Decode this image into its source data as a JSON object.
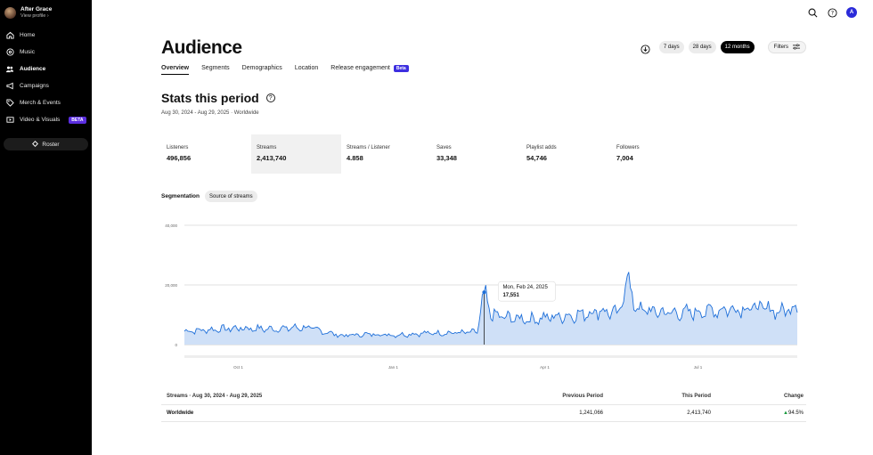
{
  "sidebar": {
    "profile": {
      "name": "After Grace",
      "sub": "View profile ›"
    },
    "items": [
      {
        "label": "Home",
        "icon": "home-icon"
      },
      {
        "label": "Music",
        "icon": "music-disc-icon"
      },
      {
        "label": "Audience",
        "icon": "audience-icon",
        "active": true
      },
      {
        "label": "Campaigns",
        "icon": "megaphone-icon"
      },
      {
        "label": "Merch & Events",
        "icon": "tag-icon"
      },
      {
        "label": "Video & Visuals",
        "icon": "video-icon",
        "badge": "BETA"
      }
    ],
    "roster": "Roster"
  },
  "header": {
    "avatar_letter": "A"
  },
  "page": {
    "title": "Audience",
    "periods": [
      "7 days",
      "28 days",
      "12 months"
    ],
    "selected_period": "12 months",
    "filters": "Filters",
    "tabs": [
      {
        "label": "Overview",
        "active": true
      },
      {
        "label": "Segments"
      },
      {
        "label": "Demographics"
      },
      {
        "label": "Location"
      },
      {
        "label": "Release engagement",
        "badge": "Beta"
      }
    ],
    "section_title": "Stats this period",
    "date_range": "Aug 30, 2024 - Aug 29, 2025 · Worldwide",
    "stats": [
      {
        "label": "Listeners",
        "value": "496,856"
      },
      {
        "label": "Streams",
        "value": "2,413,740",
        "active": true
      },
      {
        "label": "Streams / Listener",
        "value": "4.858"
      },
      {
        "label": "Saves",
        "value": "33,348"
      },
      {
        "label": "Playlist adds",
        "value": "54,746"
      },
      {
        "label": "Followers",
        "value": "7,004"
      }
    ],
    "segmentation_label": "Segmentation",
    "segmentation_value": "Source of streams"
  },
  "chart_data": {
    "type": "area",
    "ylim": [
      0,
      40000
    ],
    "y_ticks": [
      "0",
      "20,000",
      "40,000"
    ],
    "x_ticks": [
      "Oct 1",
      "Jan 1",
      "Apr 1",
      "Jul 1"
    ],
    "x": [
      "Aug 30, 2024",
      "Sep 15, 2024",
      "Oct 1, 2024",
      "Oct 20, 2024",
      "Nov 10, 2024",
      "Dec 1, 2024",
      "Dec 20, 2024",
      "Jan 1, 2025",
      "Jan 20, 2025",
      "Feb 10, 2025",
      "Feb 20, 2025",
      "Feb 24, 2025",
      "Feb 28, 2025",
      "Mar 10, 2025",
      "Mar 25, 2025",
      "Apr 1, 2025",
      "Apr 20, 2025",
      "May 5, 2025",
      "May 15, 2025",
      "May 20, 2025",
      "May 25, 2025",
      "Jun 5, 2025",
      "Jun 20, 2025",
      "Jul 1, 2025",
      "Jul 20, 2025",
      "Aug 5, 2025",
      "Aug 20, 2025",
      "Aug 29, 2025"
    ],
    "values": [
      4500,
      5000,
      5500,
      5200,
      5800,
      3000,
      3500,
      3200,
      3800,
      4000,
      4200,
      17551,
      10000,
      9000,
      8500,
      9000,
      10000,
      11500,
      10000,
      23000,
      12000,
      11000,
      10500,
      11000,
      12000,
      12500,
      11000,
      13500
    ],
    "tooltip": {
      "date": "Mon, Feb 24, 2025",
      "value": "17,551"
    },
    "color": "#1e6fd9",
    "fill": "#cfe0f7"
  },
  "table": {
    "headers": [
      "Streams · Aug 30, 2024 - Aug 29, 2025",
      "Previous Period",
      "This Period",
      "Change"
    ],
    "rows": [
      {
        "name": "Worldwide",
        "previous": "1,241,066",
        "current": "2,413,740",
        "change": "94.5%"
      }
    ]
  }
}
